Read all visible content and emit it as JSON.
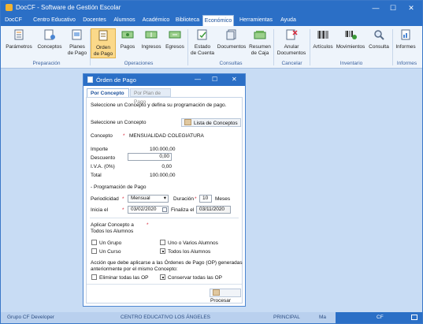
{
  "window": {
    "title": "DocCF - Software de Gestión Escolar",
    "minimize": "—",
    "maximize": "☐",
    "close": "✕"
  },
  "menu": [
    "DocCF",
    "Centro Educativo",
    "Docentes",
    "Alumnos",
    "Académico",
    "Biblioteca",
    "Económico",
    "Herramientas",
    "Ayuda"
  ],
  "menu_active": "Económico",
  "ribbon": {
    "buttons": [
      {
        "line1": "Parámetros",
        "line2": "",
        "icon": "parameters-icon"
      },
      {
        "line1": "Conceptos",
        "line2": "",
        "icon": "concepts-icon"
      },
      {
        "line1": "Planes",
        "line2": "de Pago",
        "icon": "payment-plans-icon"
      },
      {
        "line1": "Orden",
        "line2": "de Pago",
        "icon": "payment-order-icon"
      },
      {
        "line1": "Pagos",
        "line2": "",
        "icon": "payments-icon"
      },
      {
        "line1": "Ingresos",
        "line2": "",
        "icon": "income-icon"
      },
      {
        "line1": "Egresos",
        "line2": "",
        "icon": "expenses-icon"
      },
      {
        "line1": "Estado",
        "line2": "de Cuenta",
        "icon": "account-statement-icon"
      },
      {
        "line1": "Documentos",
        "line2": "",
        "icon": "documents-icon"
      },
      {
        "line1": "Resumen",
        "line2": "de Caja",
        "icon": "cash-summary-icon"
      },
      {
        "line1": "Anular",
        "line2": "Documentos",
        "icon": "cancel-documents-icon"
      },
      {
        "line1": "Artículos",
        "line2": "",
        "icon": "articles-icon"
      },
      {
        "line1": "Movimientos",
        "line2": "",
        "icon": "movements-icon"
      },
      {
        "line1": "Consulta",
        "line2": "",
        "icon": "search-icon"
      },
      {
        "line1": "Informes",
        "line2": "",
        "icon": "reports-icon"
      }
    ],
    "groups": [
      "Preparación",
      "Operaciones",
      "Consultas",
      "Cancelar",
      "Inventario",
      "Informes"
    ]
  },
  "status": {
    "left": "Grupo CF Developer",
    "center": "CENTRO EDUCATIVO LOS ÁNGELES",
    "principal": "PRINCIPAL",
    "ma": "Ma",
    "cf": "CF"
  },
  "dialog": {
    "title": "Órden de Pago",
    "tabs": [
      "Por Concepto",
      "Por Plan de Pago"
    ],
    "instructions": "Seleccione un Concepto y defina su programación de pago.",
    "select_label": "Seleccione un Concepto",
    "list_button": "Lista de Conceptos",
    "concept_label": "Concepto",
    "concept_value": "MENSUALIDAD COLEGIATURA",
    "amount": {
      "importe_label": "Importe",
      "importe_value": "100.000,00",
      "descuento_label": "Descuento",
      "descuento_value": "0,00",
      "iva_label": "I.V.A. (0%)",
      "iva_value": "0,00",
      "total_label": "Total",
      "total_value": "100.000,00"
    },
    "programming_title": "Programación de Pago",
    "periodicidad_label": "Periodicidad",
    "periodicidad_value": "Mensual",
    "duracion_label": "Duración",
    "duracion_value": "10",
    "duracion_unit": "Meses",
    "inicia_label": "Inicia el",
    "inicia_value": "03/02/2020",
    "finaliza_label": "Finaliza el",
    "finaliza_value": "03/11/2020",
    "apply_title_1": "Aplicar Concepto a",
    "apply_title_2": "Todos los Alumnos",
    "options": {
      "grupo": "Un Grupo",
      "uno_varios": "Uno o Varios Alumnos",
      "curso": "Un Curso",
      "todos": "Todos los Alumnos"
    },
    "action_text_1": "Acción que debe aplicarse a las Órdenes de Pago (OP) generadas",
    "action_text_2": "anteriormente por el mismo Concepto:",
    "eliminar": "Eliminar todas las OP",
    "conservar": "Conservar todas las OP",
    "procesar": "Procesar"
  }
}
